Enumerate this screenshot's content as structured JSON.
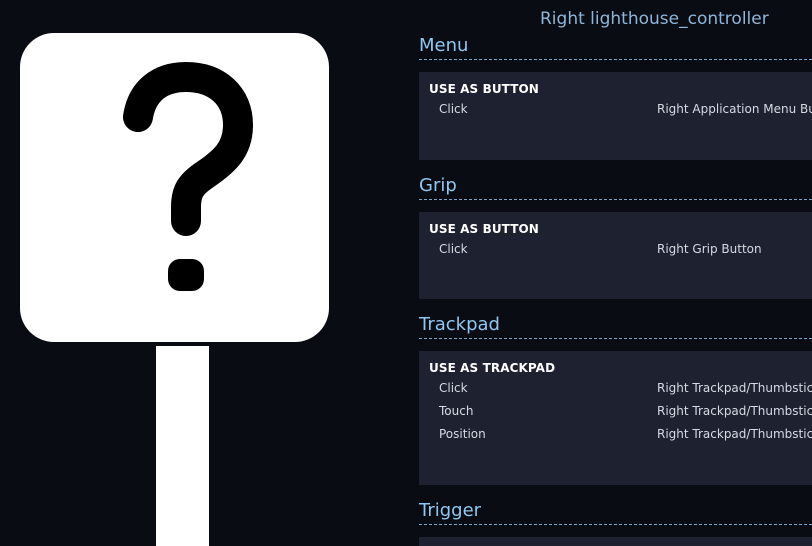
{
  "panel": {
    "title": "Right lighthouse_controller"
  },
  "sections": {
    "menu": {
      "header": "Menu",
      "use_as": "USE AS BUTTON",
      "rows": [
        {
          "input": "Click",
          "binding": "Right Application Menu Butt"
        }
      ]
    },
    "grip": {
      "header": "Grip",
      "use_as": "USE AS BUTTON",
      "rows": [
        {
          "input": "Click",
          "binding": "Right Grip Button"
        }
      ]
    },
    "trackpad": {
      "header": "Trackpad",
      "use_as": "USE AS TRACKPAD",
      "rows": [
        {
          "input": "Click",
          "binding": "Right Trackpad/Thumbstick"
        },
        {
          "input": "Touch",
          "binding": "Right Trackpad/Thumbstick"
        },
        {
          "input": "Position",
          "binding": "Right Trackpad/Thumbstick"
        }
      ]
    },
    "trigger": {
      "header": "Trigger"
    }
  },
  "controller_image": {
    "icon": "question-mark-sign-icon",
    "glyph": "?"
  },
  "colors": {
    "background": "#090c13",
    "section_box": "#1e2130",
    "header_text": "#8fc7f0",
    "title_text": "#8fb6d9"
  }
}
